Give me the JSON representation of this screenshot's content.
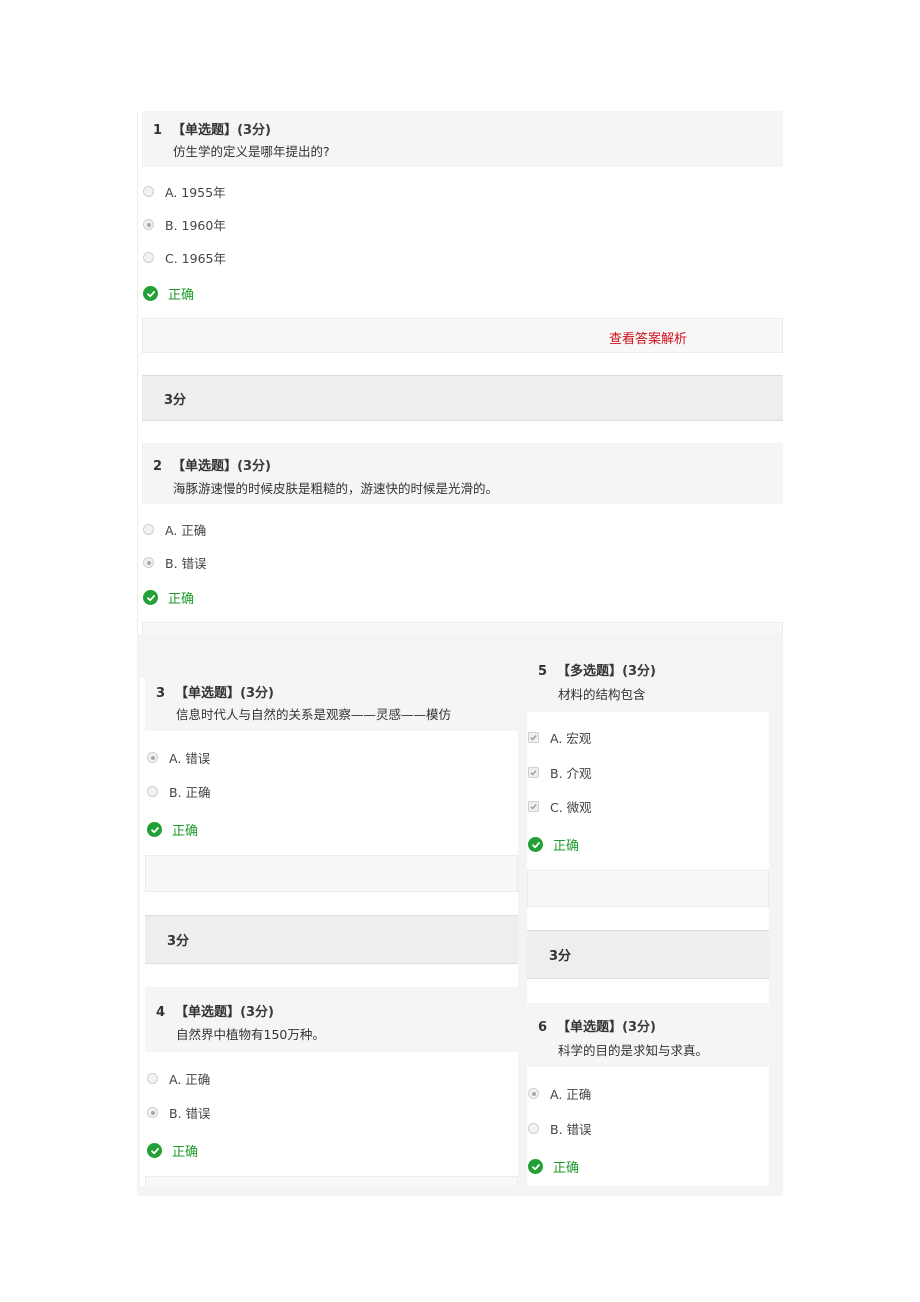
{
  "questions": [
    {
      "number": "1",
      "type": "【单选题】",
      "score": "(3分)",
      "text": "仿生学的定义是哪年提出的?",
      "input": "radio",
      "options": [
        {
          "label": "A. 1955年",
          "selected": false
        },
        {
          "label": "B. 1960年",
          "selected": true
        },
        {
          "label": "C. 1965年",
          "selected": false
        }
      ],
      "result": "正确",
      "analysis_link": "查看答案解析",
      "score_bar": "3分"
    },
    {
      "number": "2",
      "type": "【单选题】",
      "score": "(3分)",
      "text": "海豚游速慢的时候皮肤是粗糙的，游速快的时候是光滑的。",
      "input": "radio",
      "options": [
        {
          "label": "A. 正确",
          "selected": false
        },
        {
          "label": "B. 错误",
          "selected": true
        }
      ],
      "result": "正确"
    },
    {
      "number": "3",
      "type": "【单选题】",
      "score": "(3分)",
      "text": "信息时代人与自然的关系是观察——灵感——模仿",
      "input": "radio",
      "options": [
        {
          "label": "A. 错误",
          "selected": true
        },
        {
          "label": "B. 正确",
          "selected": false
        }
      ],
      "result": "正确",
      "score_bar": "3分"
    },
    {
      "number": "4",
      "type": "【单选题】",
      "score": "(3分)",
      "text": "自然界中植物有150万种。",
      "input": "radio",
      "options": [
        {
          "label": "A. 正确",
          "selected": false
        },
        {
          "label": "B. 错误",
          "selected": true
        }
      ],
      "result": "正确"
    },
    {
      "number": "5",
      "type": "【多选题】",
      "score": "(3分)",
      "text": "材料的结构包含",
      "input": "checkbox",
      "options": [
        {
          "label": "A. 宏观",
          "selected": true
        },
        {
          "label": "B. 介观",
          "selected": true
        },
        {
          "label": "C. 微观",
          "selected": true
        }
      ],
      "result": "正确",
      "score_bar": "3分"
    },
    {
      "number": "6",
      "type": "【单选题】",
      "score": "(3分)",
      "text": "科学的目的是求知与求真。",
      "input": "radio",
      "options": [
        {
          "label": "A. 正确",
          "selected": true
        },
        {
          "label": "B. 错误",
          "selected": false
        }
      ],
      "result": "正确"
    }
  ],
  "colors": {
    "correct_green": "#21a135",
    "link_red": "#d0101a"
  }
}
